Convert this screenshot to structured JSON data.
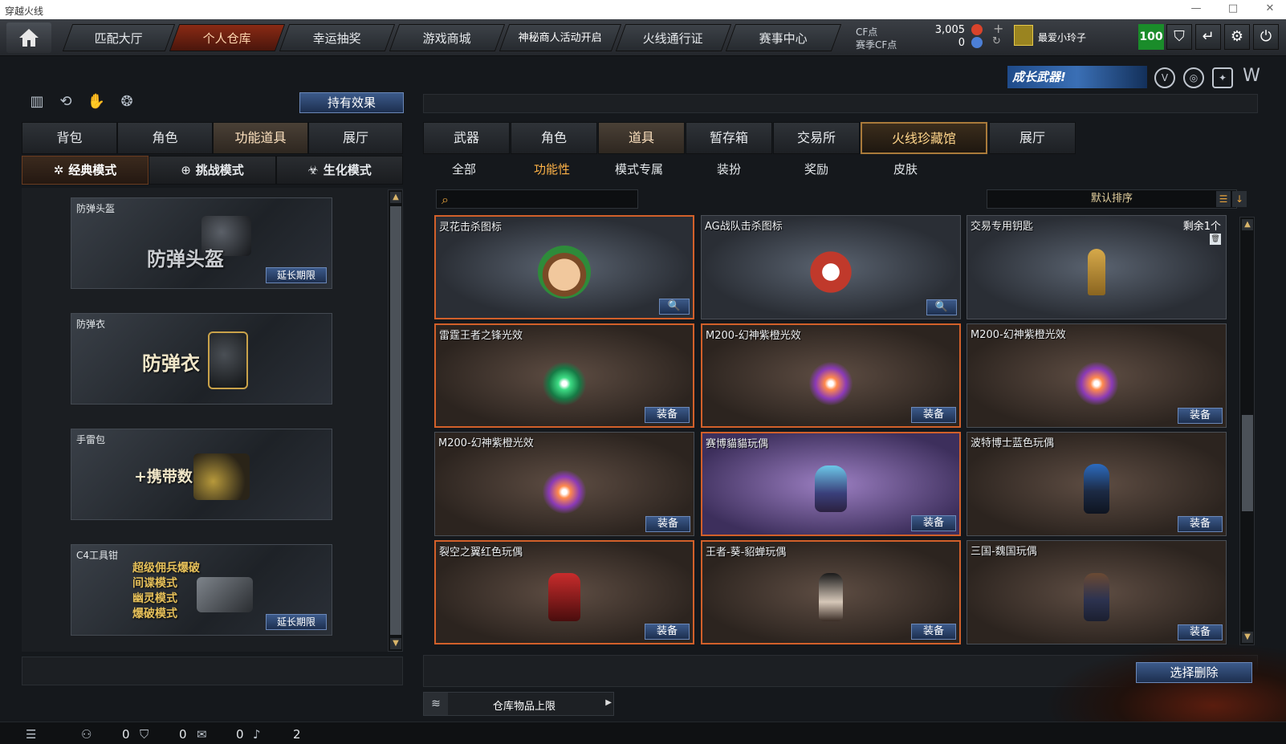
{
  "window": {
    "title": "穿越火线"
  },
  "topnav": {
    "tabs": [
      {
        "label": "匹配大厅"
      },
      {
        "label": "个人仓库"
      },
      {
        "label": "幸运抽奖"
      },
      {
        "label": "游戏商城"
      },
      {
        "label": "神秘商人活动开启"
      },
      {
        "label": "火线通行证"
      },
      {
        "label": "赛事中心"
      }
    ],
    "cf_label": "CF点",
    "cf_value": "3,005",
    "season_cf_label": "赛季CF点",
    "season_cf_value": "0",
    "username": "最爱小玲子",
    "level": "100"
  },
  "banner": {
    "text": "成长武器!"
  },
  "left": {
    "effect_button": "持有效果",
    "tabs": [
      {
        "label": "背包"
      },
      {
        "label": "角色"
      },
      {
        "label": "功能道具"
      },
      {
        "label": "展厅"
      }
    ],
    "modes": [
      {
        "label": "经典模式"
      },
      {
        "label": "挑战模式"
      },
      {
        "label": "生化模式"
      }
    ],
    "items": [
      {
        "name": "防弹头盔",
        "big": "防弹头盔",
        "action": "延长期限"
      },
      {
        "name": "防弹衣",
        "big": "防弹衣",
        "action": ""
      },
      {
        "name": "手雷包",
        "big": "+携带数",
        "action": ""
      },
      {
        "name": "C4工具钳",
        "lines": [
          "超级佣兵爆破",
          "间谍模式",
          "幽灵模式",
          "爆破模式"
        ],
        "action": "延长期限"
      }
    ]
  },
  "right": {
    "tabs": [
      {
        "label": "武器"
      },
      {
        "label": "角色"
      },
      {
        "label": "道具"
      },
      {
        "label": "暂存箱"
      },
      {
        "label": "交易所"
      },
      {
        "label": "火线珍藏馆"
      },
      {
        "label": "展厅"
      }
    ],
    "subtabs": [
      {
        "label": "全部"
      },
      {
        "label": "功能性"
      },
      {
        "label": "模式专属"
      },
      {
        "label": "装扮"
      },
      {
        "label": "奖励"
      },
      {
        "label": "皮肤"
      }
    ],
    "search": {
      "placeholder": ""
    },
    "sort_label": "默认排序",
    "items": [
      {
        "name": "灵花击杀图标",
        "button": "🔍"
      },
      {
        "name": "AG战队击杀图标",
        "button": "🔍"
      },
      {
        "name": "交易专用钥匙",
        "remaining": "剩余1个"
      },
      {
        "name": "雷霆王者之锋光效",
        "button": "装备"
      },
      {
        "name": "M200-幻神紫橙光效",
        "button": "装备"
      },
      {
        "name": "M200-幻神紫橙光效",
        "button": "装备"
      },
      {
        "name": "M200-幻神紫橙光效",
        "button": "装备"
      },
      {
        "name": "赛博貓貓玩偶",
        "button": "装备"
      },
      {
        "name": "波特博士蓝色玩偶",
        "button": "装备"
      },
      {
        "name": "裂空之翼红色玩偶",
        "button": "装备"
      },
      {
        "name": "王者-葵-貂蝉玩偶",
        "button": "装备"
      },
      {
        "name": "三国-魏国玩偶",
        "button": "装备"
      }
    ],
    "delete_button": "选择删除",
    "capacity_label": "仓库物品上限"
  },
  "status": {
    "v1": "0",
    "v2": "0",
    "v3": "0",
    "v4": "2"
  },
  "colors": {
    "accent": "#d2602a",
    "button_blue": "#3c5a8a",
    "active_orange": "#ffb347"
  }
}
